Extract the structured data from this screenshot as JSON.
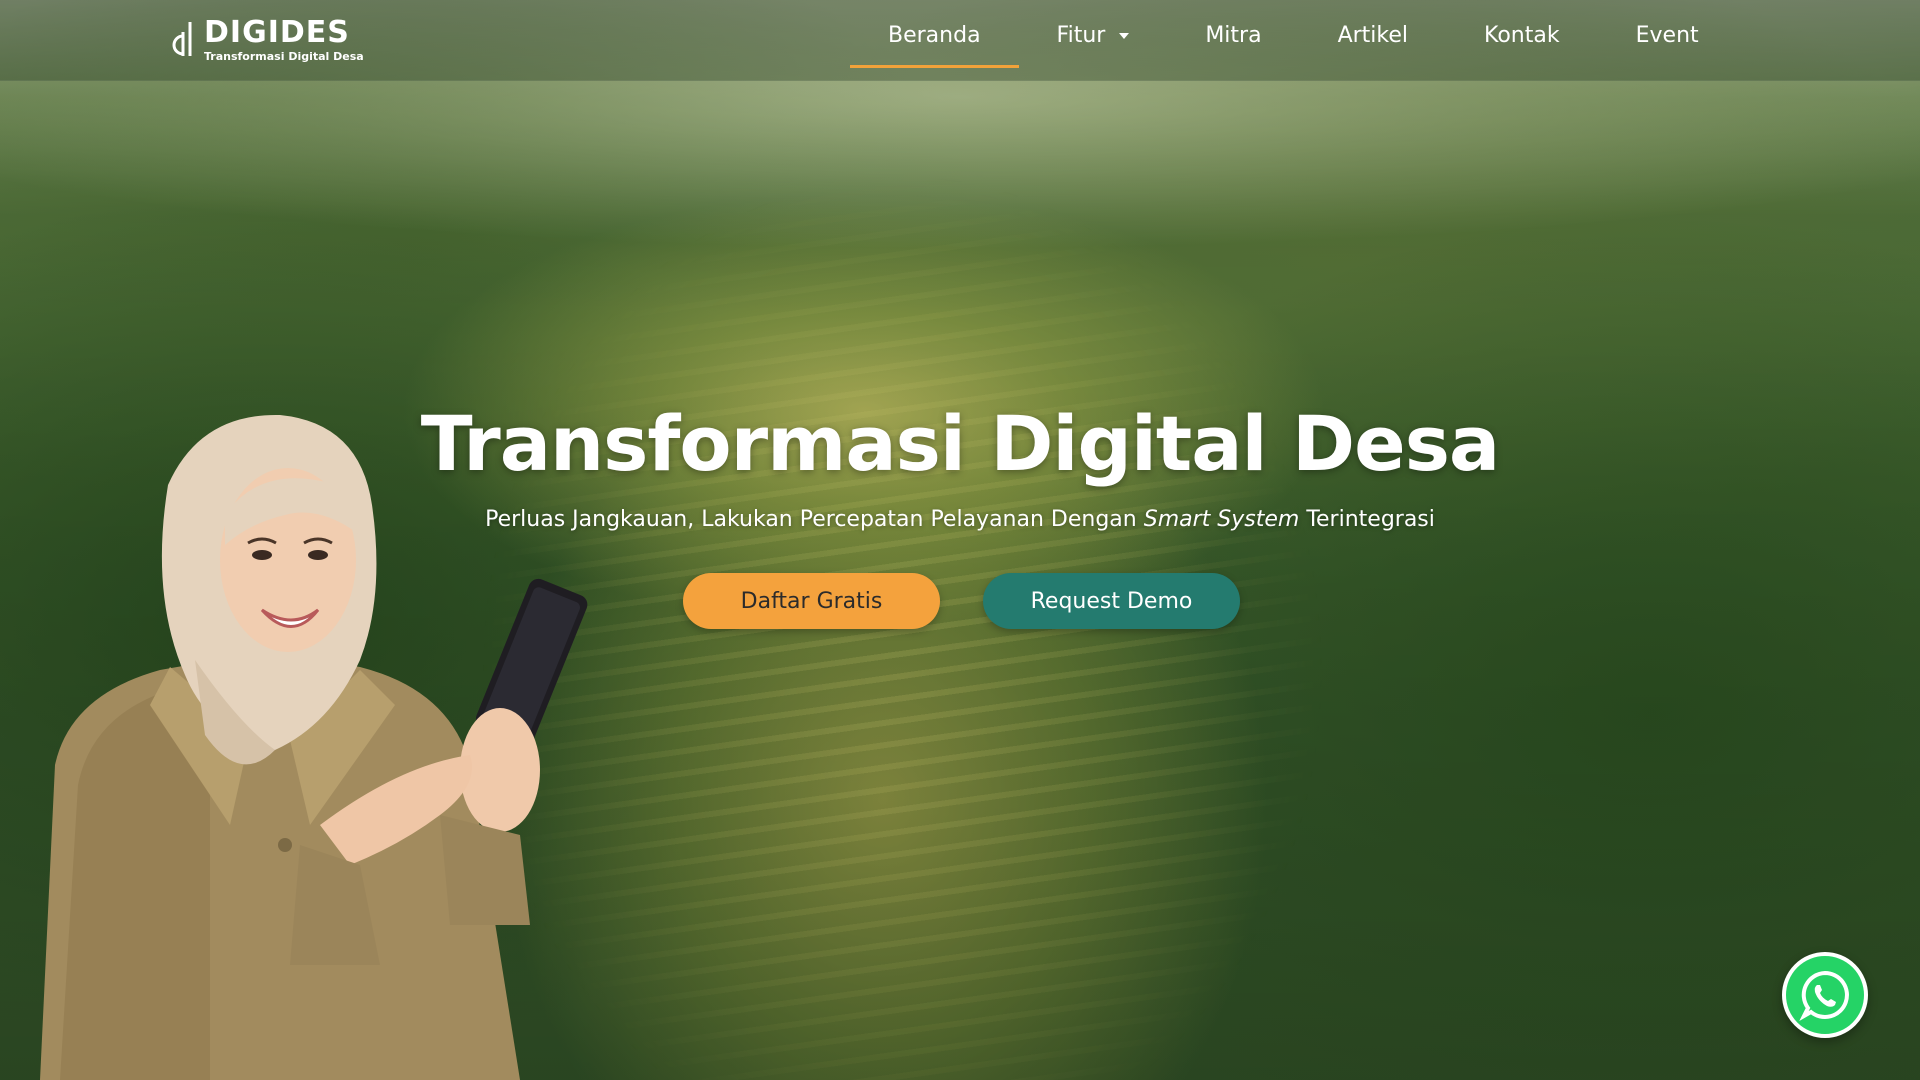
{
  "brand": {
    "name": "DIGIDES",
    "tagline": "Transformasi Digital Desa"
  },
  "nav": {
    "items": [
      {
        "label": "Beranda",
        "active": true
      },
      {
        "label": "Fitur",
        "has_dropdown": true
      },
      {
        "label": "Mitra"
      },
      {
        "label": "Artikel"
      },
      {
        "label": "Kontak"
      },
      {
        "label": "Event"
      }
    ]
  },
  "hero": {
    "title": "Transformasi Digital Desa",
    "subtitle_before": "Perluas Jangkauan, Lakukan Percepatan Pelayanan Dengan ",
    "subtitle_emphasis": "Smart System",
    "subtitle_after": " Terintegrasi",
    "primary_button": "Daftar Gratis",
    "secondary_button": "Request Demo"
  },
  "floating": {
    "icon": "whatsapp-icon"
  },
  "colors": {
    "accent_orange": "#f4a23d",
    "accent_teal": "#247b6f",
    "whatsapp_green": "#25d366",
    "nav_underline": "#f2a23a"
  }
}
